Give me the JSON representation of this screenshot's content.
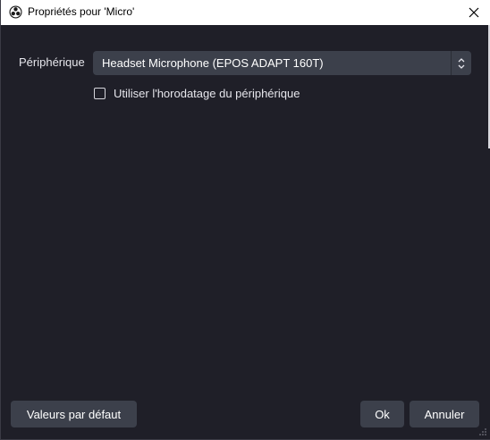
{
  "window": {
    "title": "Propriétés pour 'Micro'"
  },
  "device": {
    "label": "Périphérique",
    "selected": "Headset Microphone (EPOS ADAPT 160T)"
  },
  "options": {
    "timestamp_label": "Utiliser l'horodatage du périphérique",
    "timestamp_checked": false
  },
  "buttons": {
    "defaults": "Valeurs par défaut",
    "ok": "Ok",
    "cancel": "Annuler"
  },
  "icons": {
    "app": "obs-logo-icon",
    "close": "close-icon",
    "spin": "up-down-arrows-icon",
    "grip": "resize-grip-icon"
  },
  "colors": {
    "background": "#1f1f28",
    "control": "#3c404b",
    "text": "#e6e6ec"
  }
}
